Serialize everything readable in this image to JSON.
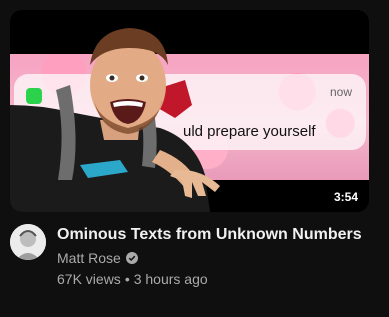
{
  "video": {
    "title": "Ominous Texts from Unknown Numbers",
    "channel": "Matt Rose",
    "views": "67K views",
    "separator": "•",
    "age": "3 hours ago",
    "duration": "3:54"
  },
  "thumbnail": {
    "notification_time": "now",
    "notification_text": "uld prepare yourself"
  },
  "icons": {
    "verified": "verified-check-icon",
    "app": "messages-app-icon"
  },
  "colors": {
    "background": "#0f0f0f",
    "title": "#f1f1f1",
    "secondary_text": "#aaaaaa",
    "thumbnail_pink": "#f6a3c1"
  }
}
